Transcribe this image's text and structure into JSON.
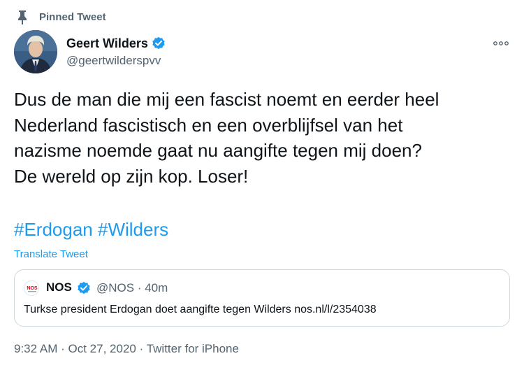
{
  "pinned": {
    "icon": "pin-icon",
    "label": "Pinned Tweet"
  },
  "author": {
    "display_name": "Geert Wilders",
    "verified_icon": "verified-badge-icon",
    "handle": "@geertwilderspvv",
    "avatar_icon": "profile-avatar"
  },
  "more_icon": "more-dots-icon",
  "tweet": {
    "text": "Dus de man die mij een fascist noemt en eerder heel\nNederland fascistisch en een overblijfsel van het\nnazisme noemde gaat nu aangifte tegen mij doen?\nDe wereld op zijn kop. Loser!",
    "hashtags": [
      "#Erdogan",
      "#Wilders"
    ],
    "translate_label": "Translate Tweet"
  },
  "quote": {
    "logo_icon": "nos-logo",
    "name": "NOS",
    "verified_icon": "verified-badge-icon",
    "handle_time": "@NOS · 40m",
    "text": "Turkse president Erdogan doet aangifte tegen Wilders nos.nl/l/2354038"
  },
  "meta": {
    "time": "9:32 AM",
    "separator": "·",
    "date": "Oct 27, 2020",
    "source": "Twitter for iPhone"
  },
  "colors": {
    "accent": "#1d9bf0",
    "secondary_text": "#536471",
    "border": "#cfd9de",
    "primary_text": "#0f1419"
  }
}
